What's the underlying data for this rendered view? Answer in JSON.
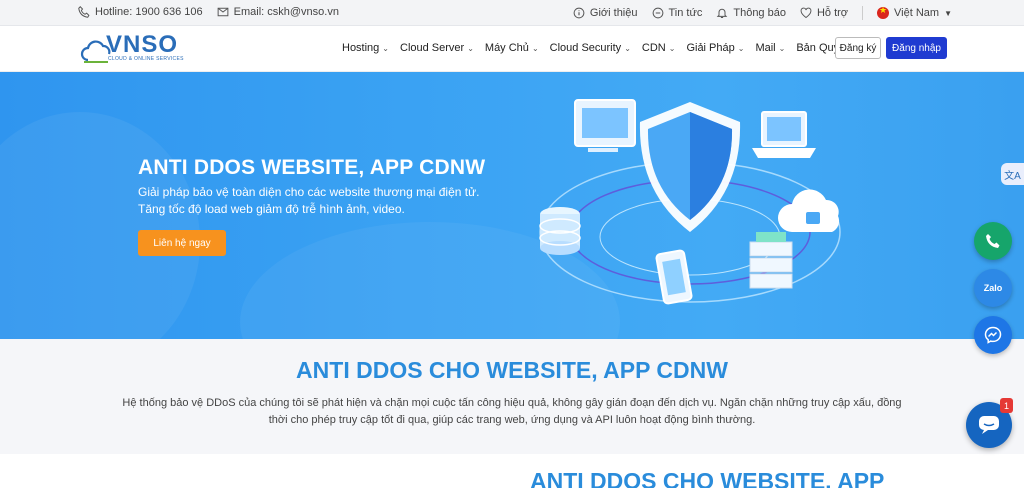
{
  "topbar": {
    "hotline": "Hotline: 1900 636 106",
    "email": "Email: cskh@vnso.vn",
    "links": [
      "Giới thiệu",
      "Tin tức",
      "Thông báo",
      "Hỗ trợ"
    ],
    "language": "Việt Nam"
  },
  "header": {
    "logo_main": "VNSO",
    "logo_sub": "CLOUD & ONLINE SERVICES",
    "nav": [
      "Hosting",
      "Cloud Server",
      "Máy Chủ",
      "Cloud Security",
      "CDN",
      "Giải Pháp",
      "Mail",
      "Bản Quyền"
    ],
    "register_label": "Đăng ký",
    "login_label": "Đăng nhập"
  },
  "hero": {
    "title": "ANTI DDOS WEBSITE, APP CDNW",
    "desc_line1": "Giải pháp bảo vệ toàn diện cho các website thương mại điện tử.",
    "desc_line2": "Tăng tốc độ load web giảm độ trễ hình ảnh, video.",
    "cta_label": "Liên hệ ngay"
  },
  "section": {
    "title": "ANTI DDOS CHO WEBSITE, APP CDNW",
    "text_line1": "Hệ thống bảo vệ DDoS của chúng tôi sẽ phát hiện và chặn mọi cuộc tấn công hiệu quả, không gây gián đoạn đến dịch vụ. Ngăn chặn những truy cập xấu, đồng",
    "text_line2": "thời cho phép truy cập tốt đi qua, giúp các trang web, ứng dụng và API luôn hoạt động bình thường.",
    "next_title": "ANTI DDOS CHO WEBSITE, APP"
  },
  "floating": {
    "zalo_label": "Zalo",
    "chat_badge": "1"
  },
  "colors": {
    "brand_blue": "#2a6db8",
    "login_blue": "#1f3bd1",
    "cta_orange": "#f7921e",
    "heading_blue": "#2a8cdb",
    "hero_bg": "#3aa2f3"
  }
}
